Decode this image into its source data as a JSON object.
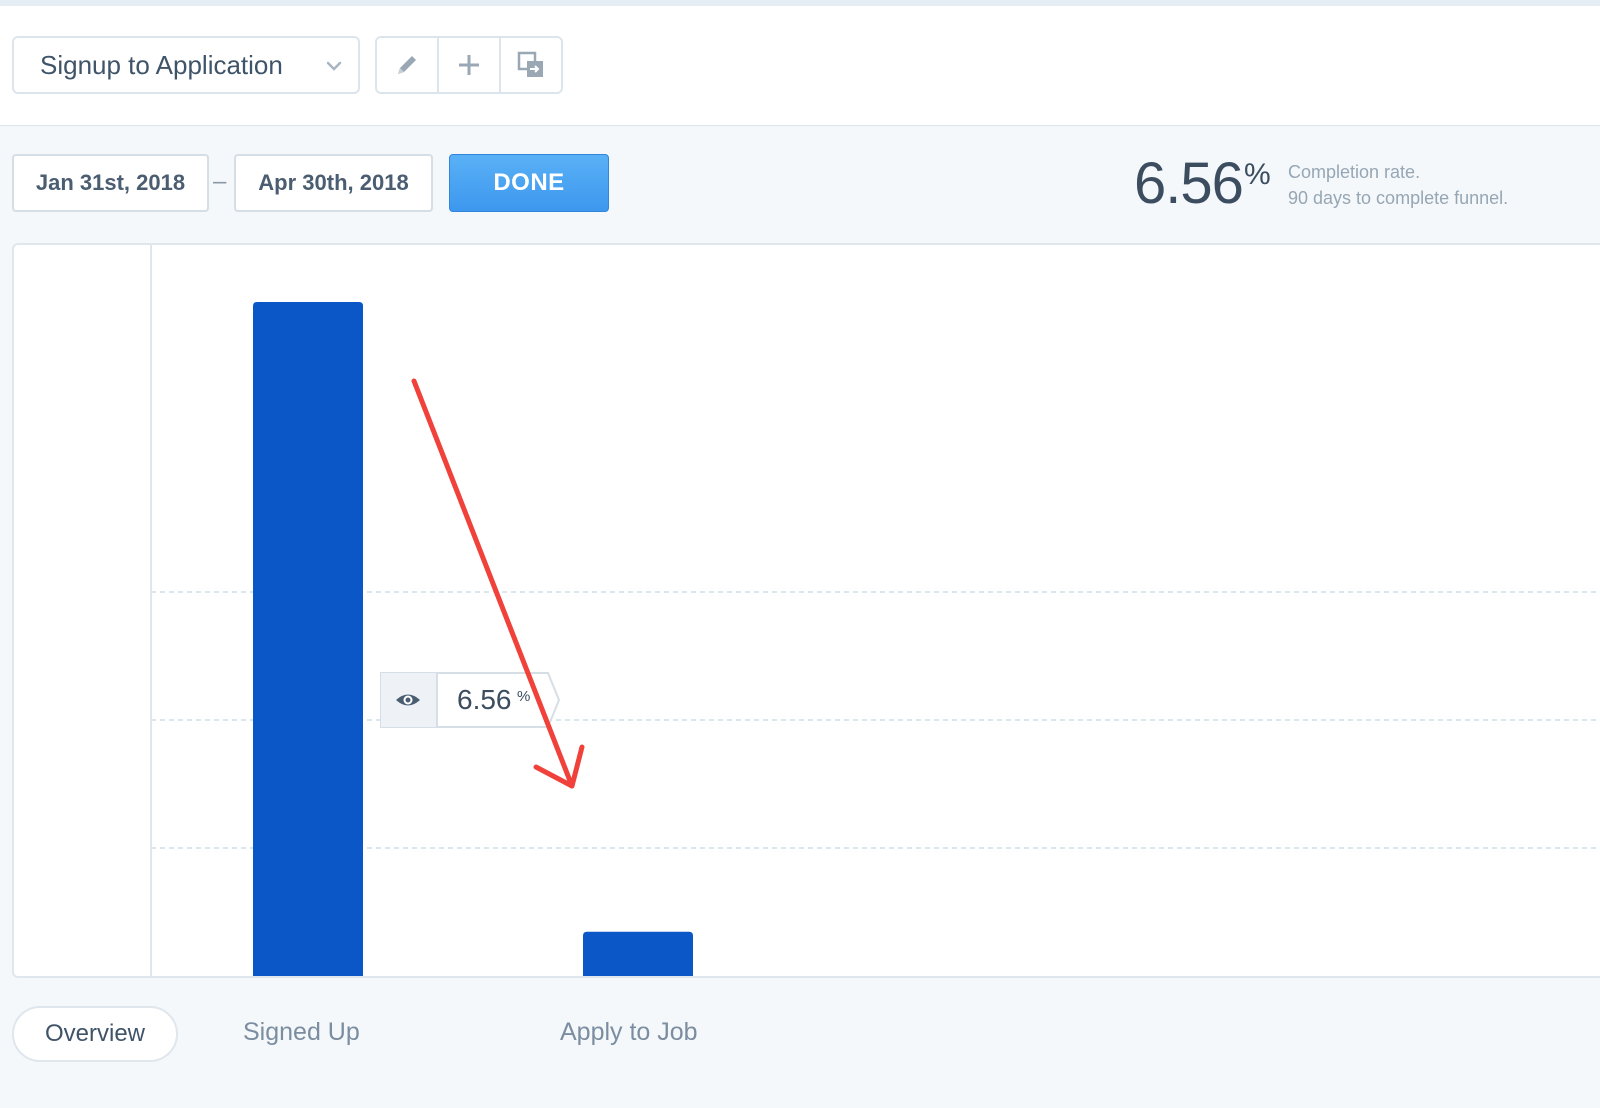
{
  "funnel_selector": {
    "label": "Signup to Application"
  },
  "toolbar": {
    "icons": [
      "pencil-icon",
      "plus-icon",
      "duplicate-icon"
    ]
  },
  "date_range": {
    "start": "Jan 31st, 2018",
    "separator": "–",
    "end": "Apr 30th, 2018"
  },
  "done_button": {
    "label": "DONE"
  },
  "completion": {
    "rate": "6.56",
    "percent_sign": "%",
    "caption_line1": "Completion rate.",
    "caption_line2": "90 days to complete funnel."
  },
  "chart_data": {
    "type": "bar",
    "categories": [
      "Signed Up",
      "Apply to Job"
    ],
    "series": [
      {
        "values": [
          100,
          6.56
        ]
      }
    ],
    "ylim": [
      0,
      100
    ],
    "grid": true,
    "gridline_fractions": [
      0.25,
      0.5,
      0.75
    ],
    "bar_color": "#0b57c8",
    "conversion_label": {
      "value": "6.56",
      "unit": "%"
    }
  },
  "annotation": {
    "color": "#f0423a"
  },
  "tabs": {
    "overview": "Overview",
    "step1": "Signed Up",
    "step2": "Apply to Job"
  },
  "colors": {
    "accent": "#3d97ee",
    "bar": "#0b57c8",
    "annotation": "#f0423a"
  }
}
